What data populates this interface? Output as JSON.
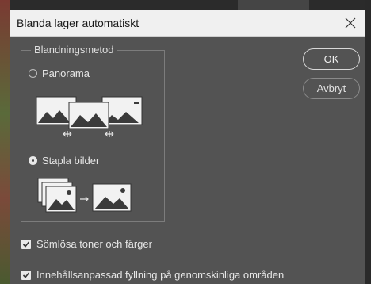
{
  "dialog": {
    "title": "Blanda lager automatiskt",
    "close_icon": "close-icon"
  },
  "method_group": {
    "legend": "Blandningsmetod",
    "options": [
      {
        "label": "Panorama",
        "selected": false,
        "icon": "panorama-illustration-icon"
      },
      {
        "label": "Stapla bilder",
        "selected": true,
        "icon": "stack-images-illustration-icon"
      }
    ]
  },
  "buttons": {
    "ok_label": "OK",
    "cancel_label": "Avbryt"
  },
  "options": {
    "seamless_label": "Sömlösa toner och färger",
    "seamless_checked": true,
    "content_aware_label": "Innehållsanpassad fyllning på genomskinliga områden",
    "content_aware_checked": true
  },
  "colors": {
    "dialog_bg": "#535353",
    "titlebar_bg": "#f0f0f0",
    "text": "#e6e6e6"
  }
}
